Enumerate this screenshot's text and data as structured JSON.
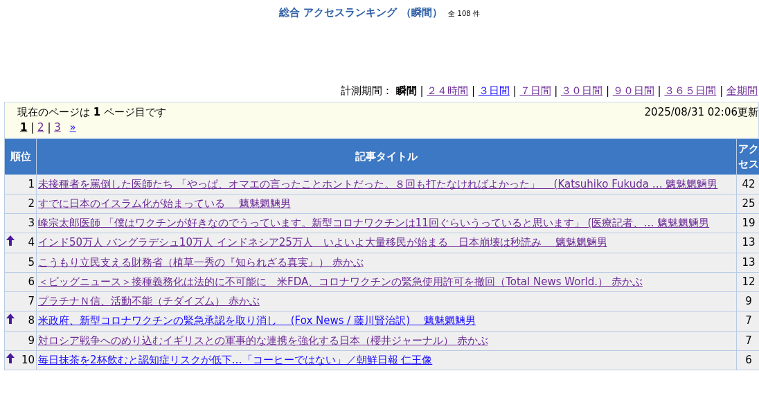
{
  "title": {
    "main": "総合 アクセスランキング （瞬間）",
    "count": "全 108 件"
  },
  "period": {
    "label": "計測期間：",
    "separator": "|",
    "options": [
      {
        "label": "瞬間",
        "selected": true
      },
      {
        "label": "２４時間",
        "selected": false,
        "visited": true
      },
      {
        "label": "３日間",
        "selected": false,
        "visited": false
      },
      {
        "label": "７日間",
        "selected": false,
        "visited": true
      },
      {
        "label": "３０日間",
        "selected": false,
        "visited": true
      },
      {
        "label": "９０日間",
        "selected": false,
        "visited": true
      },
      {
        "label": "３６５日間",
        "selected": false,
        "visited": true
      },
      {
        "label": "全期間",
        "selected": false,
        "visited": true
      }
    ]
  },
  "info": {
    "current_page_text": "現在のページは **1** ページ目です",
    "updated": "2025/08/31 02:06更新"
  },
  "pager": {
    "separator": "|",
    "pages": [
      {
        "label": "1",
        "selected": true
      },
      {
        "label": "2",
        "selected": false
      },
      {
        "label": "3",
        "selected": false
      }
    ],
    "next": "»"
  },
  "table": {
    "columns": [
      "順位",
      "記事タイトル",
      "アクセス"
    ],
    "rows": [
      {
        "rank": "1",
        "rising": false,
        "visited": true,
        "title": "未接種者を罵倒した医師たち 「やっぱ、オマエの言ったことホントだった。８回も打たなければよかった」　 (Katsuhiko Fukuda … 魑魅魍魎男",
        "access": "42"
      },
      {
        "rank": "2",
        "rising": false,
        "visited": true,
        "title": "すでに日本のイスラム化が始まっている　 魑魅魍魎男",
        "access": "25"
      },
      {
        "rank": "3",
        "rising": false,
        "visited": true,
        "title": "峰宗太郎医師 「僕はワクチンが好きなのでうっています。新型コロナワクチンは11回ぐらいうっていると思います」 (医療記者、… 魑魅魍魎男",
        "access": "19"
      },
      {
        "rank": "4",
        "rising": true,
        "visited": true,
        "title": "インド50万人 バングラデシュ10万人 インドネシア25万人　いよいよ大量移民が始まる　日本崩壊は秒読み　 魑魅魍魎男",
        "access": "13"
      },
      {
        "rank": "5",
        "rising": false,
        "visited": true,
        "title": "こうもり立民支える財務省（植草一秀の『知られざる真実』） 赤かぶ",
        "access": "13"
      },
      {
        "rank": "6",
        "rising": false,
        "visited": true,
        "title": "＜ビッグニュース＞接種義務化は法的に不可能に　米FDA、コロナワクチンの緊急使用許可を撤回（Total News World.） 赤かぶ",
        "access": "12"
      },
      {
        "rank": "7",
        "rising": false,
        "visited": true,
        "title": "プラチナＮ信、活動不能（チダイズム） 赤かぶ",
        "access": "9"
      },
      {
        "rank": "8",
        "rising": true,
        "visited": false,
        "title": "米政府、新型コロナワクチンの緊急承認を取り消し　 (Fox News / 藤川賢治訳)　 魑魅魍魎男",
        "access": "7"
      },
      {
        "rank": "9",
        "rising": false,
        "visited": true,
        "title": "対ロシア戦争へのめり込むイギリスとの軍事的な連携を強化する日本（櫻井ジャーナル） 赤かぶ",
        "access": "7"
      },
      {
        "rank": "10",
        "rising": true,
        "visited": false,
        "title": "毎日抹茶を2杯飲むと認知症リスクが低下…「コーヒーではない」／朝鮮日報 仁王像",
        "access": "6"
      }
    ]
  }
}
